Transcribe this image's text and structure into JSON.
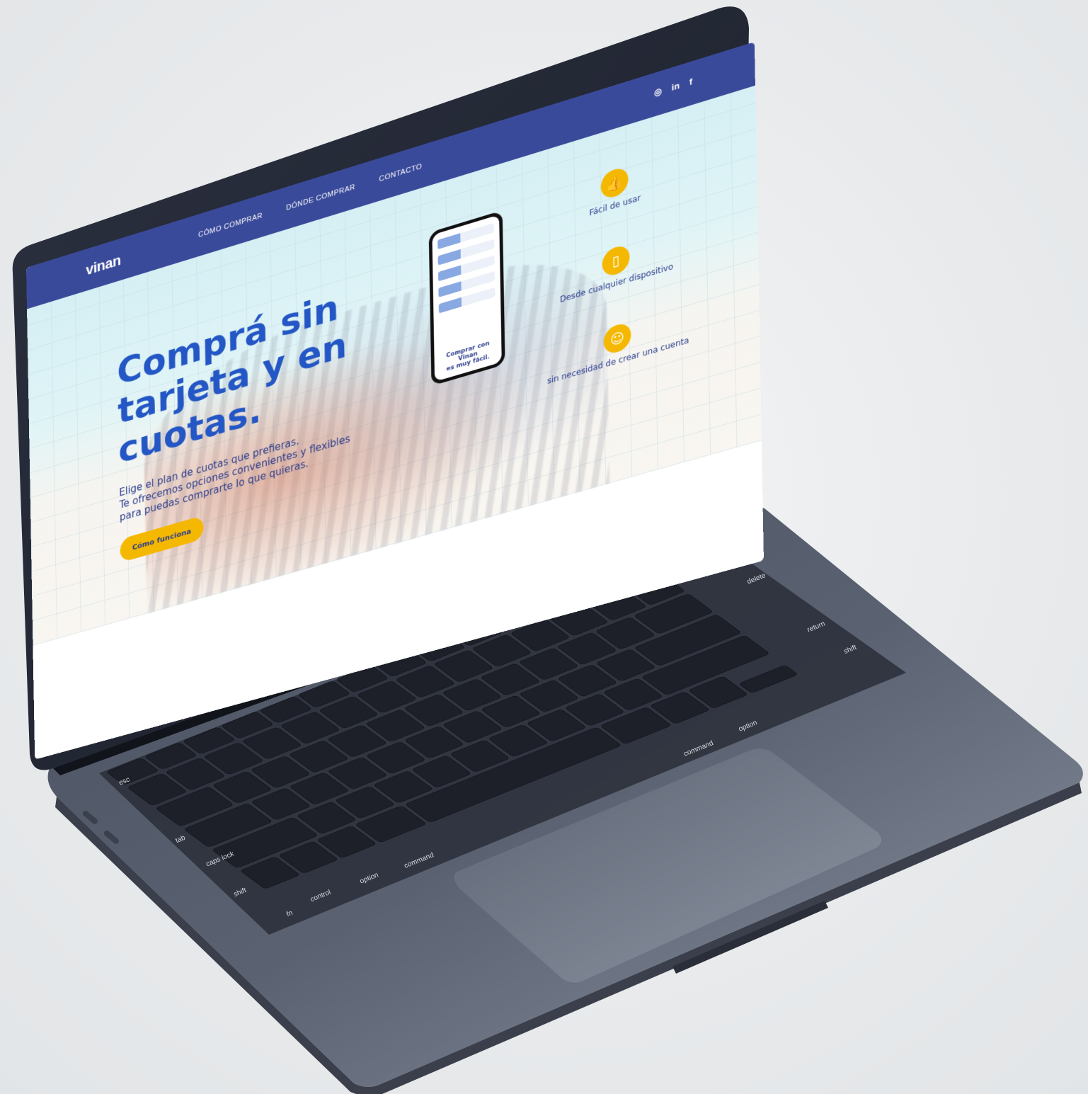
{
  "site": {
    "logo": "vinan",
    "nav": [
      "CÓMO COMPRAR",
      "DÓNDE COMPRAR",
      "CONTACTO"
    ],
    "social": [
      "instagram-icon",
      "linkedin-icon",
      "facebook-icon"
    ],
    "social_glyphs": [
      "◎",
      "in",
      "f"
    ],
    "hero": {
      "title": "Comprá sin tarjeta y en cuotas.",
      "subtitle": "Elige el plan de cuotas que prefieras.\nTe ofrecemos opciones convenientes y flexibles\npara puedas comprarte lo que quieras.",
      "cta": "Cómo funciona"
    },
    "phone_caption": "Comprar con\nVinan\nes muy fácil.",
    "features": [
      {
        "icon": "thumbs-up-icon",
        "glyph": "👍",
        "label": "Fácil de usar"
      },
      {
        "icon": "phone-icon",
        "glyph": "▯",
        "label": "Desde cualquier dispositivo"
      },
      {
        "icon": "user-icon",
        "glyph": "☺",
        "label": "sin necesidad de crear una cuenta"
      }
    ],
    "colors": {
      "header": "#3a4a9a",
      "title": "#2457c5",
      "accent": "#f5b800"
    }
  },
  "keyboard": {
    "keys": [
      "esc",
      "tab",
      "caps lock",
      "shift",
      "fn",
      "control",
      "option",
      "command",
      "command",
      "option",
      "delete",
      "return",
      "shift"
    ]
  }
}
